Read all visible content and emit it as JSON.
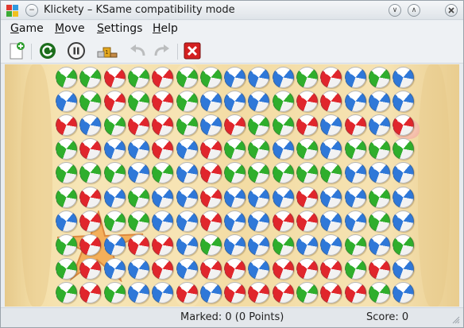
{
  "window": {
    "title": "Klickety – KSame compatibility mode",
    "minimize_glyph": "∨",
    "maximize_glyph": "∧",
    "menu_glyph": "−"
  },
  "menu": {
    "items": [
      {
        "label": "Game",
        "mnemonic": "G",
        "rest": "ame"
      },
      {
        "label": "Move",
        "mnemonic": "M",
        "rest": "ove"
      },
      {
        "label": "Settings",
        "mnemonic": "S",
        "rest": "ettings"
      },
      {
        "label": "Help",
        "mnemonic": "H",
        "rest": "elp"
      }
    ]
  },
  "toolbar": {
    "buttons": [
      {
        "name": "new-game-icon",
        "enabled": true
      },
      {
        "name": "restart-game-icon",
        "enabled": true
      },
      {
        "name": "pause-icon",
        "enabled": true
      },
      {
        "name": "highscores-icon",
        "enabled": true
      },
      {
        "name": "undo-icon",
        "enabled": false
      },
      {
        "name": "redo-icon",
        "enabled": false
      },
      {
        "name": "quit-icon",
        "enabled": true
      }
    ]
  },
  "board": {
    "colors": {
      "R": "#e0262c",
      "G": "#2fae2c",
      "B": "#2f78d8"
    },
    "rows": [
      "GGRGRGGBBBGRBGB",
      "BGRGRGBBBGRRBBB",
      "RBGRRGBRGGRBRBR",
      "GRBBRBRGGBGBGGG",
      "GGGBGBRGGGGGBBB",
      "GRBGBBRBBBRBBGB",
      "BRGGBBRBBRRBBGB",
      "GRBRRBGBBGBBGBG",
      "GRBBRBRRBRRRGRB",
      "GRGBBRBRRRGRRGB"
    ]
  },
  "status": {
    "marked": "Marked: 0 (0 Points)",
    "score": "Score: 0"
  }
}
